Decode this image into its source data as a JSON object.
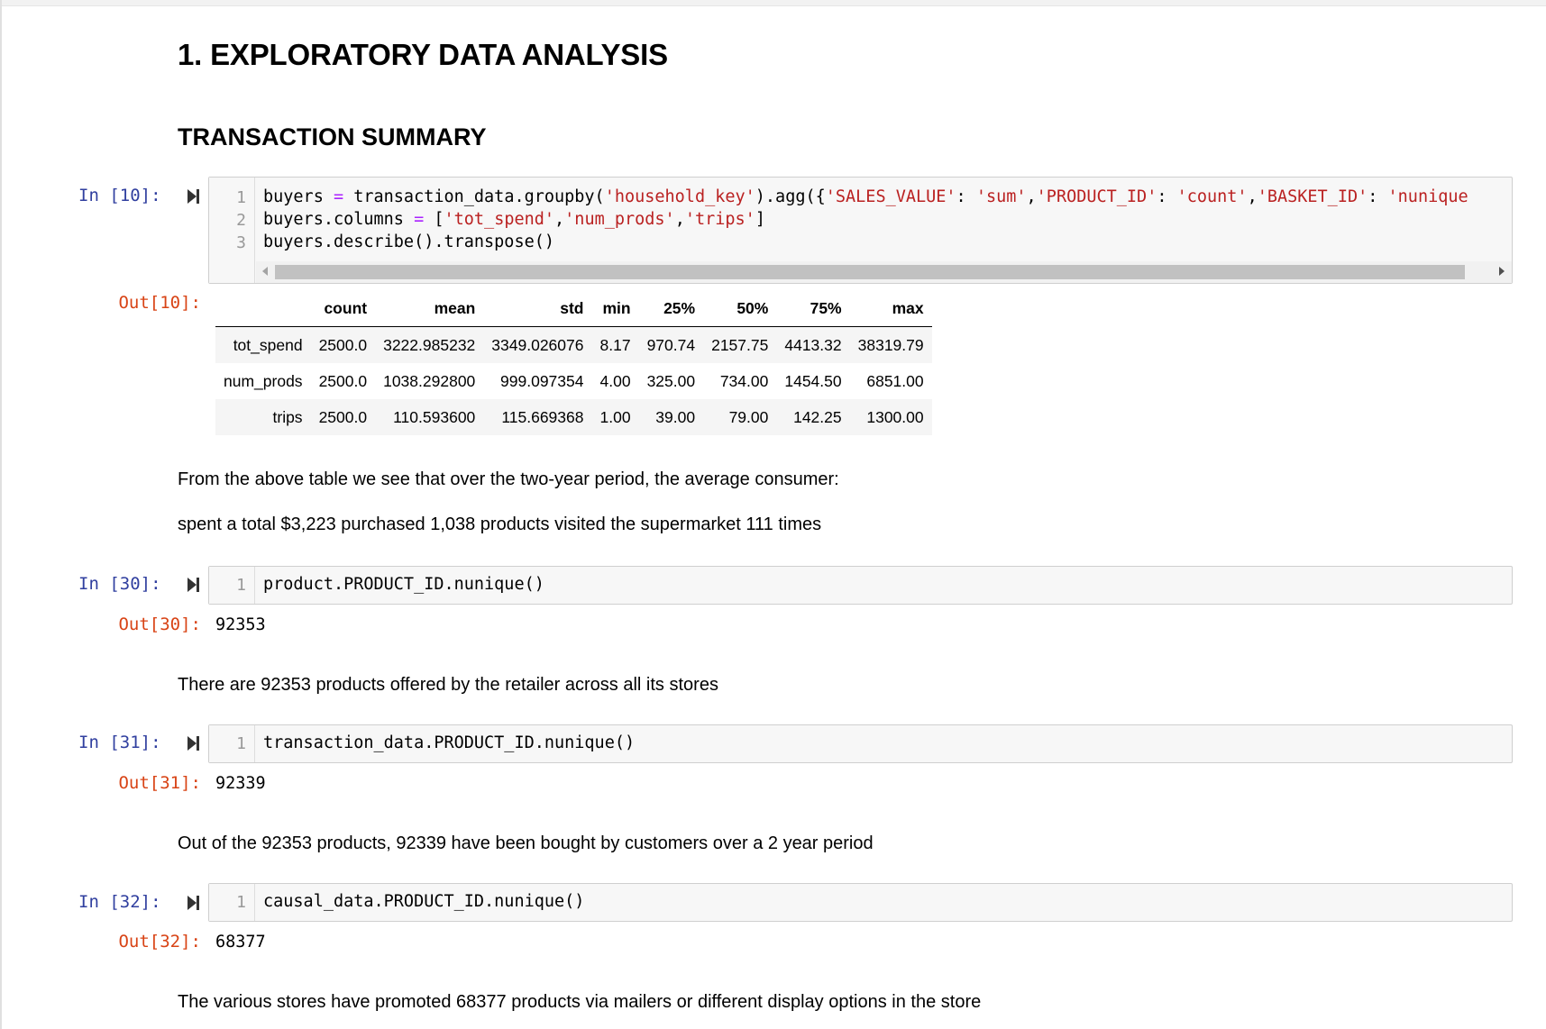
{
  "heading1": "1. EXPLORATORY DATA ANALYSIS",
  "heading2": "TRANSACTION SUMMARY",
  "cell10": {
    "in_prompt": "In [10]:",
    "out_prompt": "Out[10]:",
    "lines": [
      {
        "no": "1",
        "parts": [
          {
            "t": "buyers "
          },
          {
            "t": "=",
            "c": "op"
          },
          {
            "t": " transaction_data.groupby("
          },
          {
            "t": "'household_key'",
            "c": "str"
          },
          {
            "t": ").agg({"
          },
          {
            "t": "'SALES_VALUE'",
            "c": "str"
          },
          {
            "t": ": "
          },
          {
            "t": "'sum'",
            "c": "str"
          },
          {
            "t": ","
          },
          {
            "t": "'PRODUCT_ID'",
            "c": "str"
          },
          {
            "t": ": "
          },
          {
            "t": "'count'",
            "c": "str"
          },
          {
            "t": ","
          },
          {
            "t": "'BASKET_ID'",
            "c": "str"
          },
          {
            "t": ": "
          },
          {
            "t": "'nunique",
            "c": "str"
          }
        ]
      },
      {
        "no": "2",
        "parts": [
          {
            "t": "buyers.columns "
          },
          {
            "t": "=",
            "c": "op"
          },
          {
            "t": " ["
          },
          {
            "t": "'tot_spend'",
            "c": "str"
          },
          {
            "t": ","
          },
          {
            "t": "'num_prods'",
            "c": "str"
          },
          {
            "t": ","
          },
          {
            "t": "'trips'",
            "c": "str"
          },
          {
            "t": "]"
          }
        ]
      },
      {
        "no": "3",
        "parts": [
          {
            "t": "buyers.describe().transpose()"
          }
        ]
      }
    ],
    "table": {
      "columns": [
        "",
        "count",
        "mean",
        "std",
        "min",
        "25%",
        "50%",
        "75%",
        "max"
      ],
      "rows": [
        [
          "tot_spend",
          "2500.0",
          "3222.985232",
          "3349.026076",
          "8.17",
          "970.74",
          "2157.75",
          "4413.32",
          "38319.79"
        ],
        [
          "num_prods",
          "2500.0",
          "1038.292800",
          "999.097354",
          "4.00",
          "325.00",
          "734.00",
          "1454.50",
          "6851.00"
        ],
        [
          "trips",
          "2500.0",
          "110.593600",
          "115.669368",
          "1.00",
          "39.00",
          "79.00",
          "142.25",
          "1300.00"
        ]
      ]
    }
  },
  "md1": "From the above table we see that over the two-year period, the average consumer:",
  "md2": "spent a total $3,223 purchased 1,038 products visited the supermarket 111 times",
  "cell30": {
    "in_prompt": "In [30]:",
    "line_no": "1",
    "code": "product.PRODUCT_ID.nunique()",
    "out_prompt": "Out[30]:",
    "output": "92353"
  },
  "md3": "There are 92353 products offered by the retailer across all its stores",
  "cell31": {
    "in_prompt": "In [31]:",
    "line_no": "1",
    "code": "transaction_data.PRODUCT_ID.nunique()",
    "out_prompt": "Out[31]:",
    "output": "92339"
  },
  "md4": "Out of the 92353 products, 92339 have been bought by customers over a 2 year period",
  "cell32": {
    "in_prompt": "In [32]:",
    "line_no": "1",
    "code": "causal_data.PRODUCT_ID.nunique()",
    "out_prompt": "Out[32]:",
    "output": "68377"
  },
  "md5": "The various stores have promoted 68377 products via mailers or different display options in the store",
  "colors": {
    "in_prompt": "#303f9f",
    "out_prompt": "#d84315",
    "string": "#ba2121",
    "operator": "#aa22ff"
  },
  "icons": {
    "run": "run-cell-icon"
  }
}
